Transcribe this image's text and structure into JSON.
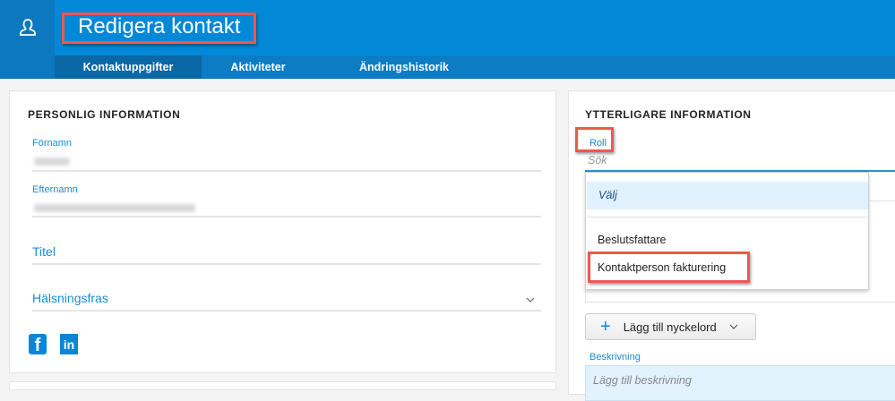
{
  "header": {
    "title": "Redigera kontakt",
    "icon": "contact-person-icon"
  },
  "tabs": [
    {
      "label": "Kontaktuppgifter",
      "active": true
    },
    {
      "label": "Aktiviteter"
    },
    {
      "label": "Ändringshistorik"
    }
  ],
  "personal": {
    "heading": "PERSONLIG INFORMATION",
    "first_name_label": "Förnamn",
    "last_name_label": "Efternamn",
    "title_label": "Titel",
    "greeting_label": "Hälsningsfras",
    "social": [
      "facebook-icon",
      "linkedin-icon"
    ]
  },
  "additional": {
    "heading": "YTTERLIGARE INFORMATION",
    "role_label": "Roll",
    "search_placeholder": "Sök",
    "options": [
      {
        "label": "Välj",
        "highlighted": true
      },
      {
        "label": "Beslutsfattare"
      },
      {
        "label": "Kontaktperson fakturering"
      }
    ],
    "keyword_button": "Lägg till nyckelord",
    "description_label": "Beskrivning",
    "description_placeholder": "Lägg till beskrivning"
  },
  "colors": {
    "brand": "#0288d6",
    "annotation": "#f0584c"
  }
}
